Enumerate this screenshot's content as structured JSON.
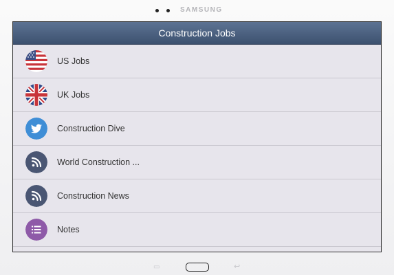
{
  "device": {
    "brand": "SAMSUNG"
  },
  "app": {
    "title": "Construction Jobs"
  },
  "menu": {
    "items": [
      {
        "label": "US Jobs",
        "icon": "us-flag-icon"
      },
      {
        "label": "UK Jobs",
        "icon": "uk-flag-icon"
      },
      {
        "label": "Construction Dive",
        "icon": "twitter-bird-icon"
      },
      {
        "label": "World Construction ...",
        "icon": "rss-icon"
      },
      {
        "label": "Construction News",
        "icon": "rss-icon"
      },
      {
        "label": "Notes",
        "icon": "list-icon"
      }
    ]
  },
  "colors": {
    "titlebar": "#4a5f80",
    "twitter": "#3f8ed6",
    "rss": "#4a5673",
    "notes": "#8e5aa8"
  },
  "nav": {
    "recent_glyph": "▭",
    "back_glyph": "↩"
  }
}
